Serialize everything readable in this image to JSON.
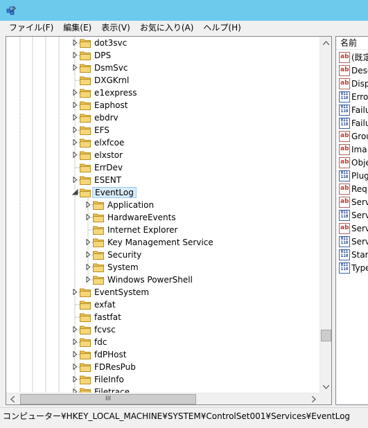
{
  "menu": [
    "ファイル(F)",
    "編集(E)",
    "表示(V)",
    "お気に入り(A)",
    "ヘルプ(H)"
  ],
  "tree": {
    "nodes": [
      {
        "label": "dot3svc",
        "level": 0,
        "expander": "collapsed"
      },
      {
        "label": "DPS",
        "level": 0,
        "expander": "collapsed"
      },
      {
        "label": "DsmSvc",
        "level": 0,
        "expander": "collapsed"
      },
      {
        "label": "DXGKrnl",
        "level": 0,
        "expander": "none"
      },
      {
        "label": "e1express",
        "level": 0,
        "expander": "collapsed"
      },
      {
        "label": "Eaphost",
        "level": 0,
        "expander": "collapsed"
      },
      {
        "label": "ebdrv",
        "level": 0,
        "expander": "collapsed"
      },
      {
        "label": "EFS",
        "level": 0,
        "expander": "collapsed"
      },
      {
        "label": "elxfcoe",
        "level": 0,
        "expander": "collapsed"
      },
      {
        "label": "elxstor",
        "level": 0,
        "expander": "collapsed"
      },
      {
        "label": "ErrDev",
        "level": 0,
        "expander": "none"
      },
      {
        "label": "ESENT",
        "level": 0,
        "expander": "collapsed"
      },
      {
        "label": "EventLog",
        "level": 0,
        "expander": "expanded",
        "selected": true
      },
      {
        "label": "Application",
        "level": 1,
        "expander": "collapsed"
      },
      {
        "label": "HardwareEvents",
        "level": 1,
        "expander": "collapsed"
      },
      {
        "label": "Internet Explorer",
        "level": 1,
        "expander": "none"
      },
      {
        "label": "Key Management Service",
        "level": 1,
        "expander": "collapsed"
      },
      {
        "label": "Security",
        "level": 1,
        "expander": "collapsed"
      },
      {
        "label": "System",
        "level": 1,
        "expander": "collapsed"
      },
      {
        "label": "Windows PowerShell",
        "level": 1,
        "expander": "collapsed"
      },
      {
        "label": "EventSystem",
        "level": 0,
        "expander": "collapsed"
      },
      {
        "label": "exfat",
        "level": 0,
        "expander": "none"
      },
      {
        "label": "fastfat",
        "level": 0,
        "expander": "none"
      },
      {
        "label": "fcvsc",
        "level": 0,
        "expander": "collapsed"
      },
      {
        "label": "fdc",
        "level": 0,
        "expander": "collapsed"
      },
      {
        "label": "fdPHost",
        "level": 0,
        "expander": "collapsed"
      },
      {
        "label": "FDResPub",
        "level": 0,
        "expander": "collapsed"
      },
      {
        "label": "FileInfo",
        "level": 0,
        "expander": "collapsed"
      },
      {
        "label": "Filetrace",
        "level": 0,
        "expander": "collapsed"
      }
    ]
  },
  "values": {
    "header": "名前",
    "rows": [
      {
        "name": "(既定",
        "type": "string"
      },
      {
        "name": "Desc",
        "type": "string"
      },
      {
        "name": "Disp",
        "type": "string"
      },
      {
        "name": "Erro",
        "type": "binary"
      },
      {
        "name": "Failu",
        "type": "binary"
      },
      {
        "name": "Failu",
        "type": "binary"
      },
      {
        "name": "Grou",
        "type": "string"
      },
      {
        "name": "Ima",
        "type": "string"
      },
      {
        "name": "Obje",
        "type": "string"
      },
      {
        "name": "Plug",
        "type": "binary"
      },
      {
        "name": "Req",
        "type": "string"
      },
      {
        "name": "Serv",
        "type": "string"
      },
      {
        "name": "Serv",
        "type": "binary"
      },
      {
        "name": "Serv",
        "type": "string"
      },
      {
        "name": "Serv",
        "type": "binary"
      },
      {
        "name": "Star",
        "type": "binary"
      },
      {
        "name": "Type",
        "type": "binary"
      }
    ],
    "string_icon_text": "ab",
    "binary_icon_text": "011\n110"
  },
  "scrollbar": {
    "hgrip": "III"
  },
  "status": "コンピューター¥HKEY_LOCAL_MACHINE¥SYSTEM¥ControlSet001¥Services¥EventLog",
  "colors": {
    "titlebar": "#6ccbed",
    "folder": "#e8c05a",
    "selection_bg": "#d9ebf9",
    "selection_border": "#99c9ef"
  }
}
